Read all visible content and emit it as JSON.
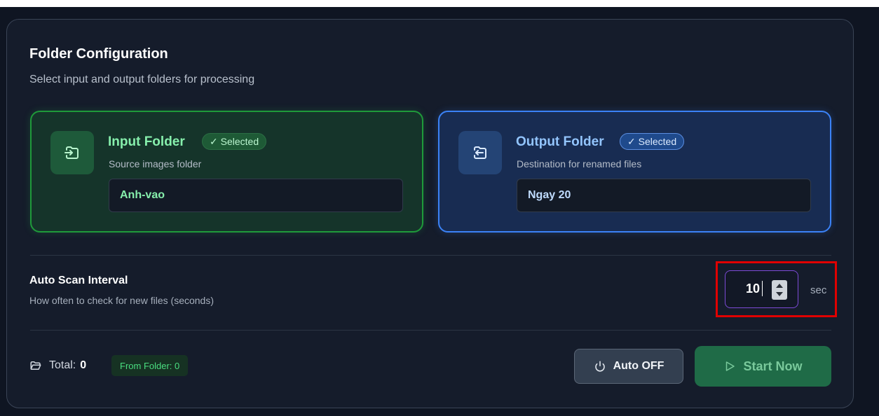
{
  "header": {
    "title": "Folder Configuration",
    "subtitle": "Select input and output folders for processing"
  },
  "input_folder": {
    "title": "Input Folder",
    "badge": "✓ Selected",
    "description": "Source images folder",
    "value": "Anh-vao",
    "icon": "folder-input-icon"
  },
  "output_folder": {
    "title": "Output Folder",
    "badge": "✓ Selected",
    "description": "Destination for renamed files",
    "value": "Ngay 20",
    "icon": "folder-output-icon"
  },
  "auto_scan": {
    "label": "Auto Scan Interval",
    "description": "How often to check for new files (seconds)",
    "value": "10",
    "unit": "sec"
  },
  "footer": {
    "total_label": "Total:",
    "total_value": "0",
    "from_folder": "From Folder: 0",
    "auto_button": "Auto OFF",
    "start_button": "Start Now"
  },
  "colors": {
    "background": "#0f1522",
    "panel": "#151c2b",
    "input_accent": "#1f9a3a",
    "output_accent": "#3b82f6",
    "highlight": "#e00000",
    "start_button": "#1f6b47"
  }
}
